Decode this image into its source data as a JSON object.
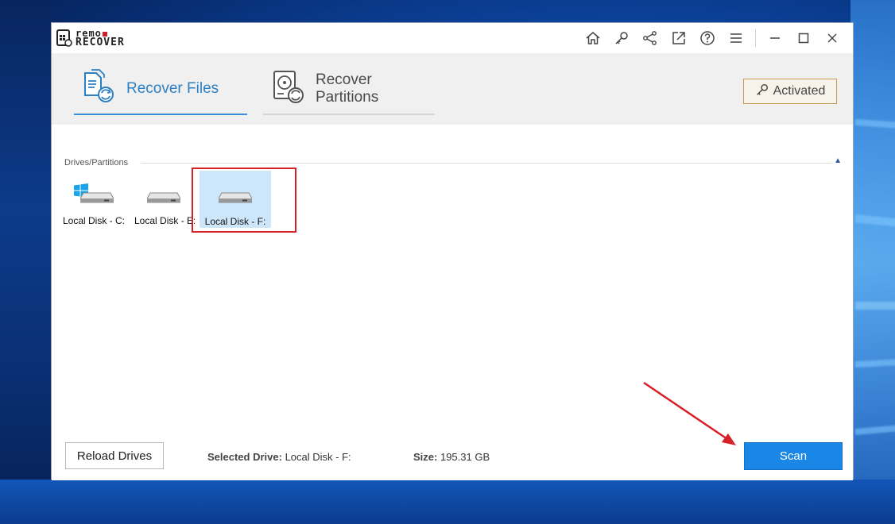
{
  "app": {
    "logo_top": "remo",
    "logo_bottom": "RECOVER"
  },
  "titlebar": {
    "icons": [
      "home-icon",
      "key-icon",
      "share-icon",
      "export-icon",
      "help-icon",
      "menu-icon",
      "minimize-icon",
      "maximize-icon",
      "close-icon"
    ]
  },
  "tabs": [
    {
      "label": "Recover Files",
      "icon": "recover-files-icon",
      "active": true
    },
    {
      "label": "Recover Partitions",
      "icon": "recover-partitions-icon",
      "active": false
    }
  ],
  "activated": {
    "label": "Activated",
    "icon": "key-icon"
  },
  "drives_section": {
    "label": "Drives/Partitions"
  },
  "drives": [
    {
      "name": "Local Disk - C:",
      "icon": "windows-drive-icon",
      "selected": false
    },
    {
      "name": "Local Disk - E:",
      "icon": "drive-icon",
      "selected": false
    },
    {
      "name": "Local Disk - F:",
      "icon": "drive-icon",
      "selected": true
    }
  ],
  "footer": {
    "reload_label": "Reload Drives",
    "selected_drive_label": "Selected Drive:",
    "selected_drive_value": "Local Disk - F:",
    "size_label": "Size:",
    "size_value": "195.31 GB",
    "scan_label": "Scan"
  },
  "colors": {
    "accent": "#1a86e6",
    "tab_active": "#2d7fc4",
    "highlight": "#d91f26",
    "activated_border": "#c99b55",
    "selected_bg": "#cde6fa"
  }
}
